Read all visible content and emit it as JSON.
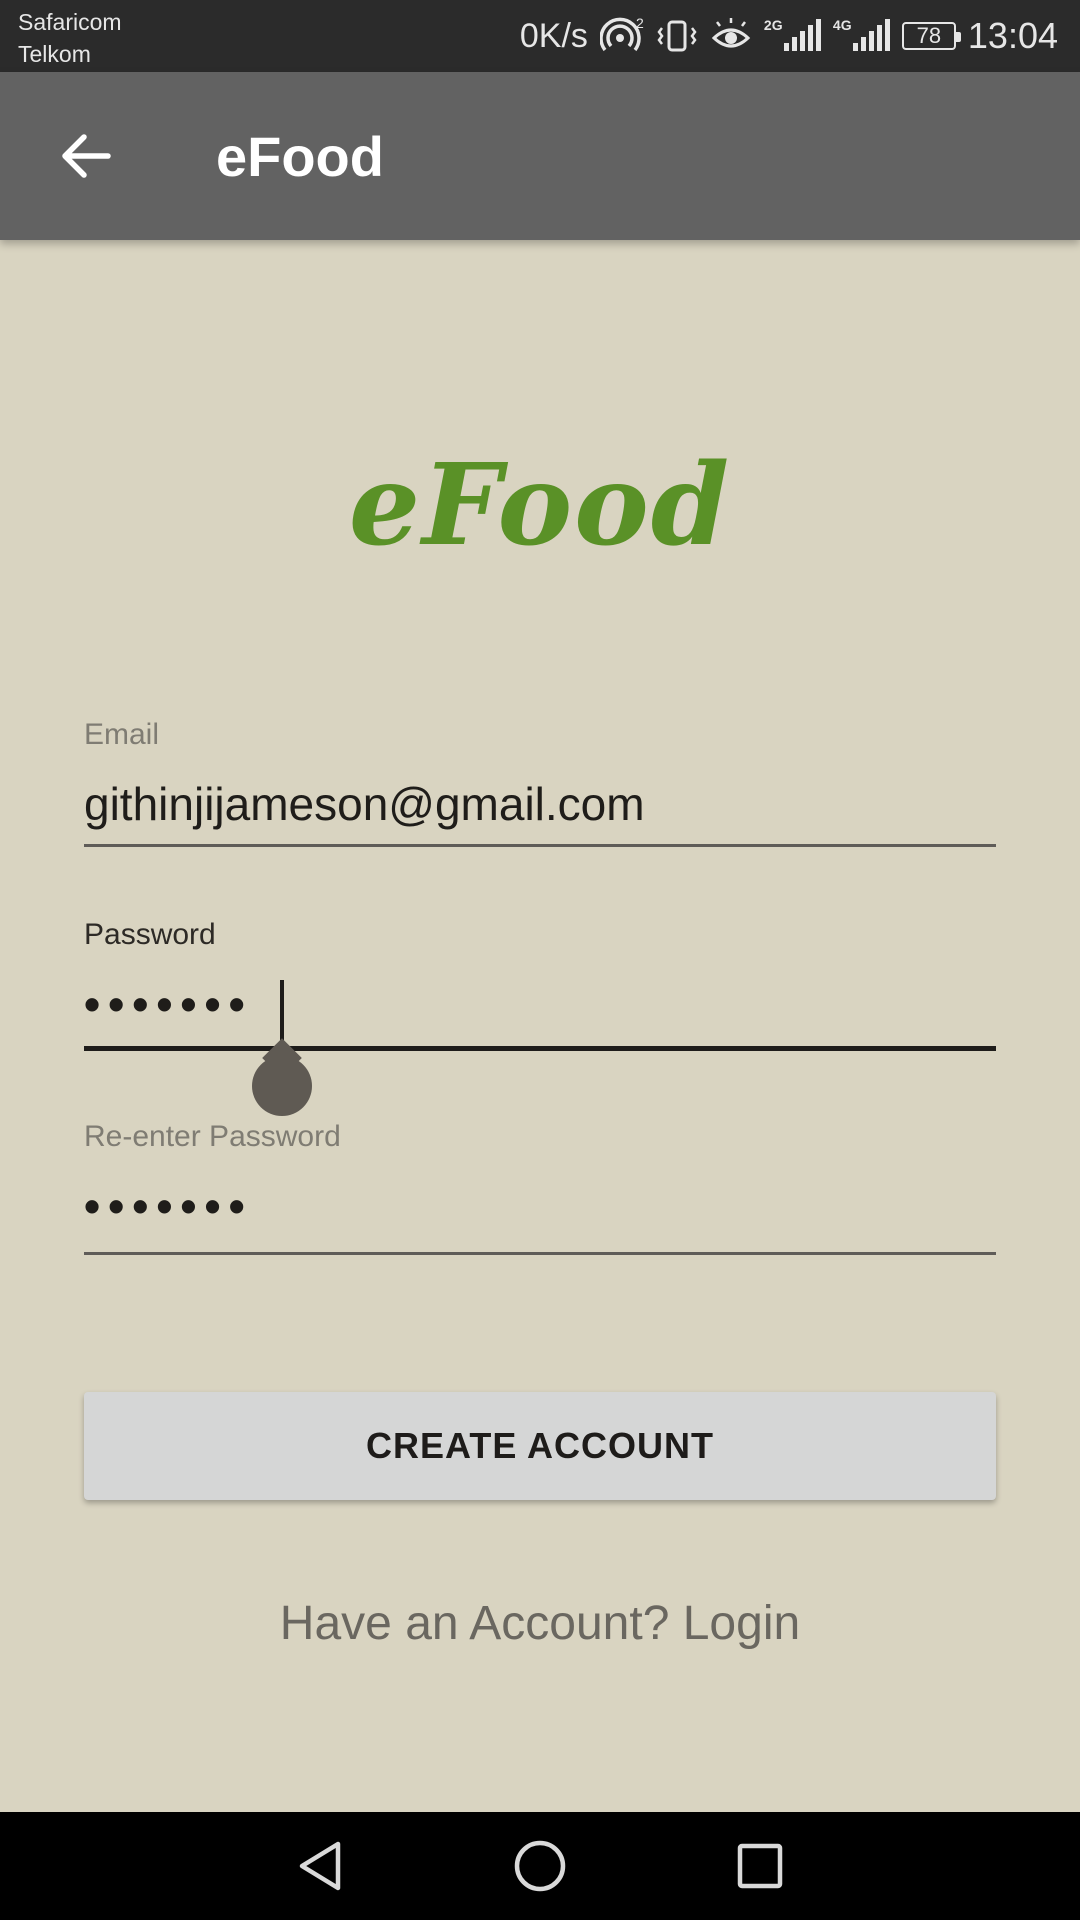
{
  "status_bar": {
    "carrier_1": "Safaricom",
    "carrier_2": "Telkom",
    "net_speed": "0K/s",
    "hotspot_superscript": "2",
    "signal_1_tag": "2G",
    "signal_2_tag": "4G",
    "battery": "78",
    "time": "13:04",
    "icons": [
      "hotspot-icon",
      "vibrate-icon",
      "eye-comfort-icon",
      "signal-icon",
      "signal-icon",
      "battery-icon"
    ]
  },
  "app_bar": {
    "title": "eFood",
    "back_icon": "arrow-back-icon"
  },
  "logo": {
    "text": "eFood",
    "color": "#5a9127"
  },
  "form": {
    "email": {
      "label": "Email",
      "value": "githinjijameson@gmail.com"
    },
    "password": {
      "label": "Password",
      "value": "•••••••",
      "focused": true
    },
    "reenter_password": {
      "label": "Re-enter Password",
      "value": "•••••••"
    }
  },
  "actions": {
    "create_account": "CREATE ACCOUNT",
    "login_link": "Have an Account? Login"
  },
  "nav_bar": {
    "icons": [
      "back-triangle-icon",
      "home-circle-icon",
      "recents-square-icon"
    ]
  },
  "colors": {
    "background": "#d9d4c1",
    "app_bar": "#626262",
    "status_bar": "#2b2b2b",
    "accent_green": "#5a9127",
    "button": "#d5d6d6"
  }
}
